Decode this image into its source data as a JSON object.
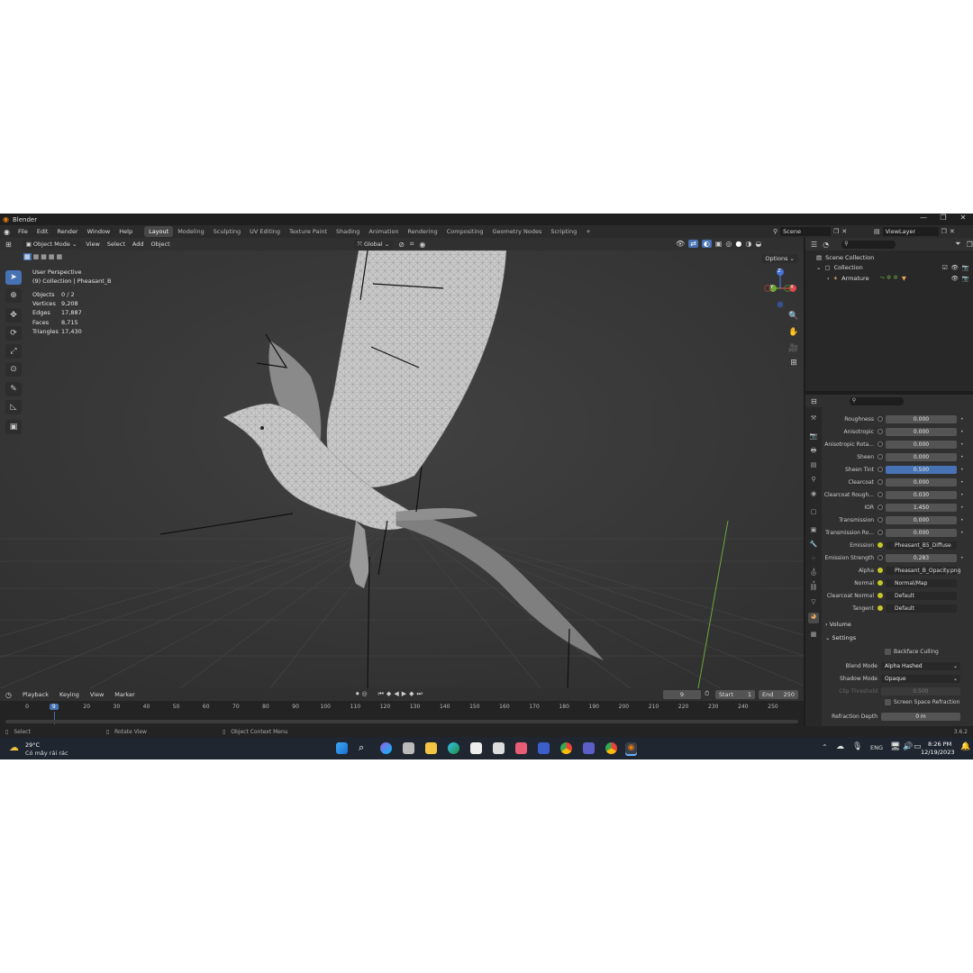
{
  "window": {
    "title": "Blender",
    "controls": [
      "—",
      "❐",
      "✕"
    ]
  },
  "menu": [
    "File",
    "Edit",
    "Render",
    "Window",
    "Help"
  ],
  "workspaces": [
    "Layout",
    "Modeling",
    "Sculpting",
    "UV Editing",
    "Texture Paint",
    "Shading",
    "Animation",
    "Rendering",
    "Compositing",
    "Geometry Nodes",
    "Scripting"
  ],
  "active_workspace": "Layout",
  "scene": {
    "name": "Scene",
    "view_layer": "ViewLayer"
  },
  "viewport": {
    "mode": "Object Mode",
    "menus": [
      "View",
      "Select",
      "Add",
      "Object"
    ],
    "transform": "Global",
    "options_label": "Options",
    "view_name": "User Perspective",
    "collection_info": "(9) Collection | Pheasant_B",
    "stats": [
      {
        "label": "Objects",
        "value": "0 / 2"
      },
      {
        "label": "Vertices",
        "value": "9,208"
      },
      {
        "label": "Edges",
        "value": "17,887"
      },
      {
        "label": "Faces",
        "value": "8,715"
      },
      {
        "label": "Triangles",
        "value": "17,430"
      }
    ],
    "gizmo_axes": {
      "z": "Z",
      "y": "Y",
      "x": "X"
    }
  },
  "outliner": {
    "items": [
      {
        "label": "Scene Collection"
      },
      {
        "label": "Collection"
      },
      {
        "label": "Armature"
      }
    ]
  },
  "properties": {
    "rows": [
      {
        "label": "Roughness",
        "value": "0.000"
      },
      {
        "label": "Anisotropic",
        "value": "0.000"
      },
      {
        "label": "Anisotropic Rota...",
        "value": "0.000"
      },
      {
        "label": "Sheen",
        "value": "0.000"
      },
      {
        "label": "Sheen Tint",
        "value": "0.500"
      },
      {
        "label": "Clearcoat",
        "value": "0.000"
      },
      {
        "label": "Clearcoat Rough...",
        "value": "0.030"
      },
      {
        "label": "IOR",
        "value": "1.450"
      },
      {
        "label": "Transmission",
        "value": "0.000"
      },
      {
        "label": "Transmission Ro...",
        "value": "0.000"
      },
      {
        "label": "Emission",
        "value": "Pheasant_B5_Diffuse"
      },
      {
        "label": "Emission Strength",
        "value": "0.283"
      },
      {
        "label": "Alpha",
        "value": "Pheasant_B_Opacity.png"
      },
      {
        "label": "Normal",
        "value": "Normal/Map"
      },
      {
        "label": "Clearcoat Normal",
        "value": "Default"
      },
      {
        "label": "Tangent",
        "value": "Default"
      }
    ],
    "sections": {
      "volume": "Volume",
      "settings": "Settings"
    },
    "settings": {
      "backface_culling": "Backface Culling",
      "blend_mode_label": "Blend Mode",
      "blend_mode": "Alpha Hashed",
      "shadow_mode_label": "Shadow Mode",
      "shadow_mode": "Opaque",
      "clip_threshold_label": "Clip Threshold",
      "clip_threshold": "0.500",
      "ssr": "Screen Space Refraction",
      "refraction_depth_label": "Refraction Depth",
      "refraction_depth": "0 m"
    }
  },
  "timeline": {
    "menus": [
      "Playback",
      "Keying",
      "View",
      "Marker"
    ],
    "current_frame": "9",
    "start_label": "Start",
    "start": "1",
    "end_label": "End",
    "end": "250",
    "ticks": [
      "0",
      "9",
      "20",
      "30",
      "40",
      "50",
      "60",
      "70",
      "80",
      "90",
      "100",
      "110",
      "120",
      "130",
      "140",
      "150",
      "160",
      "170",
      "180",
      "190",
      "200",
      "210",
      "220",
      "230",
      "240",
      "250"
    ]
  },
  "statusbar": {
    "select": "Select",
    "rotate": "Rotate View",
    "context": "Object Context Menu",
    "version": "3.6.2"
  },
  "taskbar": {
    "temperature": "29°C",
    "weather": "Có mây rải rác",
    "language": "ENG",
    "time": "8:26 PM",
    "date": "12/19/2023"
  },
  "colors": {
    "accent": "#4772b3",
    "viewport_bg": "#3a3a3a",
    "panel": "#303030",
    "axis_x": "#e0454b",
    "axis_y": "#6ea83a",
    "axis_z": "#4772d8"
  }
}
